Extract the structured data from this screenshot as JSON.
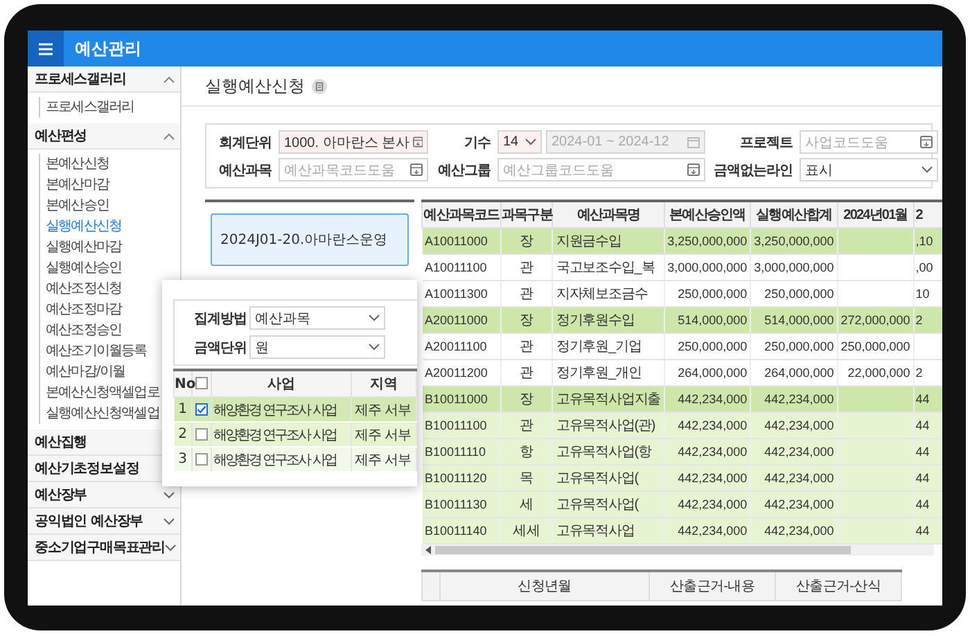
{
  "app": {
    "title": "예산관리"
  },
  "sidebar": {
    "sections": [
      {
        "label": "프로세스갤러리",
        "expanded": true,
        "children": [
          {
            "label": "프로세스갤러리",
            "selected": false
          }
        ]
      },
      {
        "label": "예산편성",
        "expanded": true,
        "children": [
          {
            "label": "본예산신청",
            "selected": false
          },
          {
            "label": "본예산마감",
            "selected": false
          },
          {
            "label": "본예산승인",
            "selected": false
          },
          {
            "label": "실행예산신청",
            "selected": true
          },
          {
            "label": "실행예산마감",
            "selected": false
          },
          {
            "label": "실행예산승인",
            "selected": false
          },
          {
            "label": "예산조정신청",
            "selected": false
          },
          {
            "label": "예산조정마감",
            "selected": false
          },
          {
            "label": "예산조정승인",
            "selected": false
          },
          {
            "label": "예산조기이월등록",
            "selected": false
          },
          {
            "label": "예산마감/이월",
            "selected": false
          },
          {
            "label": "본예산신청액셀업로",
            "selected": false
          },
          {
            "label": "실행예산신청액셀업",
            "selected": false
          }
        ]
      },
      {
        "label": "예산집행",
        "expanded": false
      },
      {
        "label": "예산기초정보설정",
        "expanded": false
      },
      {
        "label": "예산장부",
        "expanded": false
      },
      {
        "label": "공익법인 예산장부",
        "expanded": false
      },
      {
        "label": "중소기업구매목표관리",
        "expanded": false
      }
    ]
  },
  "page": {
    "title": "실행예산신청"
  },
  "filters": [
    {
      "label": "회계단위",
      "kind": "code",
      "value": "1000. 아마란스 본사",
      "required": true
    },
    {
      "label": "기수",
      "kind": "period",
      "value": "14",
      "range": "2024-01 ~ 2024-12",
      "disabled": true
    },
    {
      "label": "프로젝트",
      "kind": "code",
      "placeholder": "사업코드도움"
    },
    {
      "label": "예산과목",
      "kind": "code",
      "placeholder": "예산과목코드도움"
    },
    {
      "label": "예산그룹",
      "kind": "code",
      "placeholder": "예산그룹코드도움"
    },
    {
      "label": "금액없는라인",
      "kind": "select",
      "value": "표시"
    }
  ],
  "cards": [
    {
      "title": "2024J01-20.아마란스운영",
      "selected": true
    }
  ],
  "grid": {
    "columns": [
      "예산과목코드",
      "과목구분",
      "예산과목명",
      "본예산승인액",
      "실행예산합계",
      "2024년01월",
      "2"
    ],
    "rows": [
      {
        "color": "#cde6a9",
        "cells": [
          "A10011000",
          "장",
          "지원금수입",
          "3,250,000,000",
          "3,250,000,000",
          null,
          ",10"
        ]
      },
      {
        "color": "#ffffff",
        "cells": [
          "A10011100",
          "관",
          "국고보조수입_복",
          "3,000,000,000",
          "3,000,000,000",
          null,
          ",00"
        ]
      },
      {
        "color": "#ffffff",
        "cells": [
          "A10011300",
          "관",
          "지자체보조금수",
          "250,000,000",
          "250,000,000",
          null,
          "10"
        ]
      },
      {
        "color": "#cde6a9",
        "cells": [
          "A20011000",
          "장",
          "정기후원수입",
          "514,000,000",
          "514,000,000",
          "272,000,000",
          "2"
        ]
      },
      {
        "color": "#ffffff",
        "cells": [
          "A20011100",
          "관",
          "정기후원_기업",
          "250,000,000",
          "250,000,000",
          "250,000,000",
          null
        ]
      },
      {
        "color": "#ffffff",
        "cells": [
          "A20011200",
          "관",
          "정기후원_개인",
          "264,000,000",
          "264,000,000",
          "22,000,000",
          "2"
        ]
      },
      {
        "color": "#cde6a9",
        "cells": [
          "B10011000",
          "장",
          "고유목적사업지출",
          "442,234,000",
          "442,234,000",
          null,
          "44"
        ]
      },
      {
        "color": "#e6f4d2",
        "cells": [
          "B10011100",
          "관",
          "고유목적사업(관)",
          "442,234,000",
          "442,234,000",
          null,
          "44"
        ]
      },
      {
        "color": "#e6f4d2",
        "cells": [
          "B10011110",
          "항",
          "고유목적사업(항",
          "442,234,000",
          "442,234,000",
          null,
          "44"
        ]
      },
      {
        "color": "#e6f4d2",
        "cells": [
          "B10011120",
          "목",
          "고유목적사업(",
          "442,234,000",
          "442,234,000",
          null,
          "44"
        ]
      },
      {
        "color": "#e6f4d2",
        "cells": [
          "B10011130",
          "세",
          "고유목적사업(",
          "442,234,000",
          "442,234,000",
          null,
          "44"
        ]
      },
      {
        "color": "#e6f4d2",
        "cells": [
          "B10011140",
          "세세",
          "고유목적사업",
          "442,234,000",
          "442,234,000",
          null,
          "44"
        ]
      }
    ]
  },
  "detail_table": {
    "columns": [
      "신청년월",
      "산출근거-내용",
      "산출근거-산식"
    ]
  },
  "popup": {
    "fields": [
      {
        "label": "집계방법",
        "value": "예산과목"
      },
      {
        "label": "금액단위",
        "value": "원"
      }
    ],
    "columns": [
      "No",
      "사업",
      "지역"
    ],
    "select_all_checked": false,
    "rows": [
      {
        "no": "1",
        "checked": true,
        "project": "해양환경 연구조사 사업",
        "region": "제주 서부",
        "color": "#d3e9b3"
      },
      {
        "no": "2",
        "checked": false,
        "project": "해양환경 연구조사 사업",
        "region": "제주 서부",
        "color": "#e6f4d2"
      },
      {
        "no": "3",
        "checked": false,
        "project": "해양환경 연구조사 사업",
        "region": "제주 서부",
        "color": "#f2f9ea"
      }
    ]
  }
}
